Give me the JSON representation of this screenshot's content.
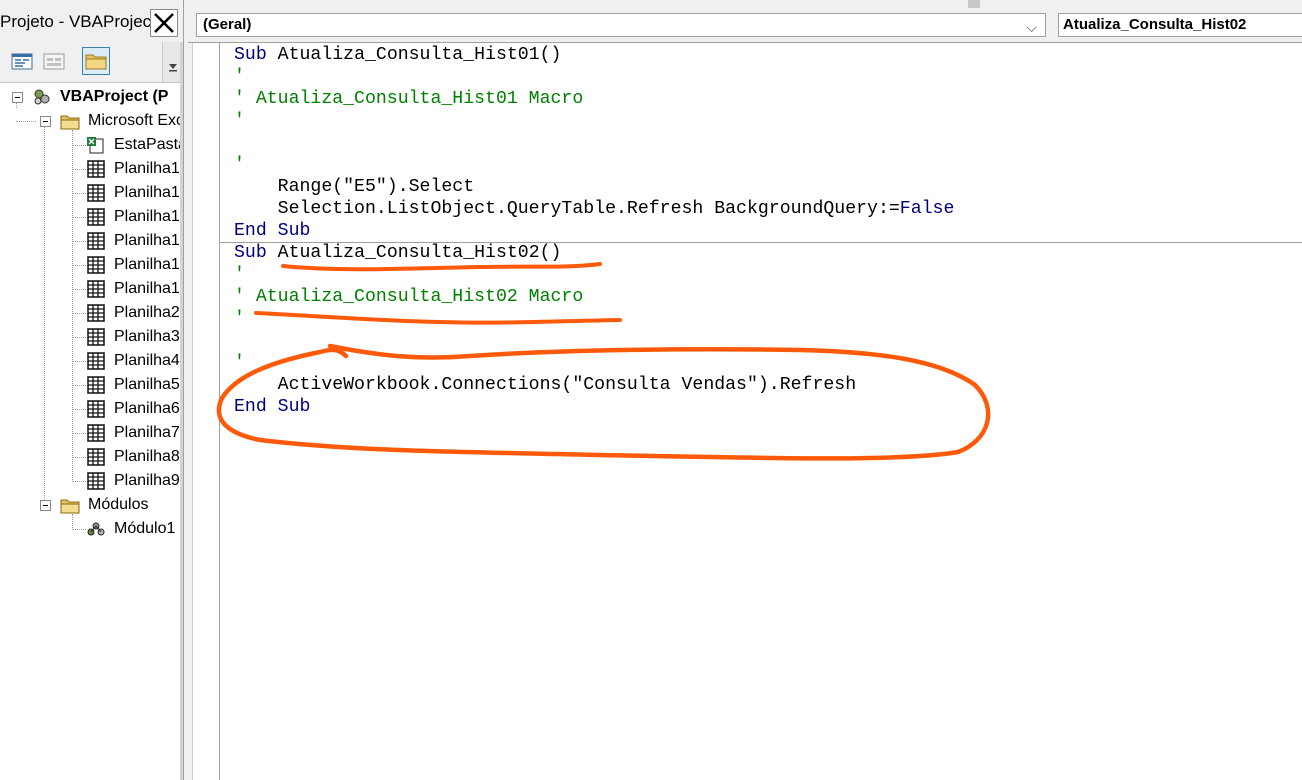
{
  "project_pane": {
    "title": "Projeto - VBAProjec",
    "close_glyph": "✕",
    "toolbar": {
      "view_code_icon": "view-code-icon",
      "view_object_icon": "view-object-icon",
      "toggle_folders_icon": "folder-icon"
    },
    "tree": {
      "root": "VBAProject (P",
      "excel_objects_folder": "Microsoft Exc",
      "excel_objects": [
        "EstaPasta",
        "Planilha1",
        "Planilha1",
        "Planilha1",
        "Planilha1",
        "Planilha1",
        "Planilha1",
        "Planilha2",
        "Planilha3",
        "Planilha4",
        "Planilha5",
        "Planilha6",
        "Planilha7",
        "Planilha8",
        "Planilha9"
      ],
      "modules_folder": "Módulos",
      "modules": [
        "Módulo1"
      ]
    }
  },
  "code_window": {
    "object_combo": "(Geral)",
    "object_combo_arrow": "⌵",
    "procedure_combo": "Atualiza_Consulta_Hist02",
    "lines": [
      [
        {
          "t": "Sub ",
          "c": "kw"
        },
        {
          "t": "Atualiza_Consulta_Hist01()",
          "c": "tx"
        }
      ],
      [
        {
          "t": "'",
          "c": "cm"
        }
      ],
      [
        {
          "t": "' Atualiza_Consulta_Hist01 Macro",
          "c": "cm"
        }
      ],
      [
        {
          "t": "'",
          "c": "cm"
        }
      ],
      [],
      [
        {
          "t": "'",
          "c": "cm"
        }
      ],
      [
        {
          "t": "    Range(\"E5\").Select",
          "c": "tx"
        }
      ],
      [
        {
          "t": "    Selection.ListObject.QueryTable.Refresh BackgroundQuery:=",
          "c": "tx"
        },
        {
          "t": "False",
          "c": "kw"
        }
      ],
      [
        {
          "t": "End Sub",
          "c": "kw"
        }
      ],
      [
        {
          "t": "Sub ",
          "c": "kw"
        },
        {
          "t": "Atualiza_Consulta_Hist02()",
          "c": "tx"
        }
      ],
      [
        {
          "t": "'",
          "c": "cm"
        }
      ],
      [
        {
          "t": "' Atualiza_Consulta_Hist02 Macro",
          "c": "cm"
        }
      ],
      [
        {
          "t": "'",
          "c": "cm"
        }
      ],
      [],
      [
        {
          "t": "'",
          "c": "cm"
        }
      ],
      [
        {
          "t": "    ActiveWorkbook.Connections(\"Consulta Vendas\").Refresh",
          "c": "tx"
        }
      ],
      [
        {
          "t": "End Sub",
          "c": "kw"
        }
      ]
    ]
  },
  "colors": {
    "keyword": "#00007f",
    "comment": "#007f00",
    "annotation": "#ff5a0a"
  }
}
